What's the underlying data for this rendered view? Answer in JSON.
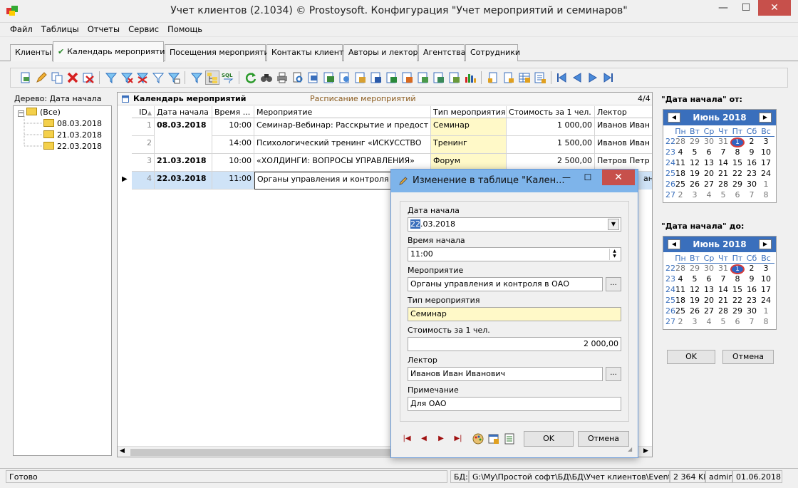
{
  "window": {
    "title": "Учет клиентов (2.1034) © Prostoysoft. Конфигурация \"Учет мероприятий и семинаров\""
  },
  "menu": [
    "Файл",
    "Таблицы",
    "Отчеты",
    "Сервис",
    "Помощь"
  ],
  "tabs": [
    "Клиенты",
    "Календарь мероприятий",
    "Посещения мероприятий",
    "Контакты клиента",
    "Авторы и лекторы",
    "Агентства",
    "Сотрудники"
  ],
  "tree": {
    "label": "Дерево: Дата начала",
    "root": "(Все)",
    "items": [
      "08.03.2018",
      "21.03.2018",
      "22.03.2018"
    ]
  },
  "grid": {
    "title": "Календарь мероприятий",
    "subtitle": "Расписание мероприятий",
    "count": "4/4",
    "columns": [
      "ID",
      "Дата начала",
      "Время ...",
      "Мероприятие",
      "Тип мероприятия",
      "Стоимость за 1 чел.",
      "Лектор"
    ],
    "rows": [
      {
        "id": "1",
        "date": "08.03.2018",
        "time": "10:00",
        "event": "Семинар-Вебинар: Расскрытие и предост",
        "type": "Семинар",
        "cost": "1 000,00",
        "lector": "Иванов Иван"
      },
      {
        "id": "2",
        "date": "",
        "time": "14:00",
        "event": "Психологический тренинг «ИСКУССТВО",
        "type": "Тренинг",
        "cost": "1 500,00",
        "lector": "Иванов Иван"
      },
      {
        "id": "3",
        "date": "21.03.2018",
        "time": "10:00",
        "event": "«ХОЛДИНГИ: ВОПРОСЫ УПРАВЛЕНИЯ»",
        "type": "Форум",
        "cost": "2 500,00",
        "lector": "Петров Петр I"
      },
      {
        "id": "4",
        "date": "22.03.2018",
        "time": "11:00",
        "event": "Органы управления и контроля",
        "type": "",
        "cost": "",
        "lector": "ан"
      }
    ]
  },
  "calendar_from": {
    "label": "\"Дата начала\" от:",
    "month": "Июнь 2018",
    "dow": [
      "Пн",
      "Вт",
      "Ср",
      "Чт",
      "Пт",
      "Сб",
      "Вс"
    ],
    "weeks": [
      "22",
      "23",
      "24",
      "25",
      "26",
      "27"
    ],
    "days": [
      [
        "28",
        "29",
        "30",
        "31",
        "1",
        "2",
        "3"
      ],
      [
        "4",
        "5",
        "6",
        "7",
        "8",
        "9",
        "10"
      ],
      [
        "11",
        "12",
        "13",
        "14",
        "15",
        "16",
        "17"
      ],
      [
        "18",
        "19",
        "20",
        "21",
        "22",
        "23",
        "24"
      ],
      [
        "25",
        "26",
        "27",
        "28",
        "29",
        "30",
        "1"
      ],
      [
        "2",
        "3",
        "4",
        "5",
        "6",
        "7",
        "8"
      ]
    ]
  },
  "calendar_to": {
    "label": "\"Дата начала\" до:",
    "month": "Июнь 2018"
  },
  "right_buttons": {
    "ok": "OK",
    "cancel": "Отмена"
  },
  "dialog": {
    "title": "Изменение в таблице \"Кален...",
    "fields": {
      "date_label": "Дата начала",
      "date_sel": "22",
      "date_rest": ".03.2018",
      "time_label": "Время начала",
      "time_value": "11:00",
      "event_label": "Мероприятие",
      "event_value": "Органы управления и контроля в ОАО",
      "type_label": "Тип мероприятия",
      "type_value": "Семинар",
      "cost_label": "Стоимость за 1 чел.",
      "cost_value": "2 000,00",
      "lector_label": "Лектор",
      "lector_value": "Иванов Иван Иванович",
      "note_label": "Примечание",
      "note_value": "Для ОАО"
    },
    "ok": "OK",
    "cancel": "Отмена"
  },
  "status": {
    "ready": "Готово",
    "db_label": "БД:",
    "db_path": "G:\\My\\Простой софт\\БД\\БД\\Учет клиентов\\Events.mdb",
    "size": "2 364 Kb",
    "user": "admin",
    "date": "01.06.2018"
  }
}
